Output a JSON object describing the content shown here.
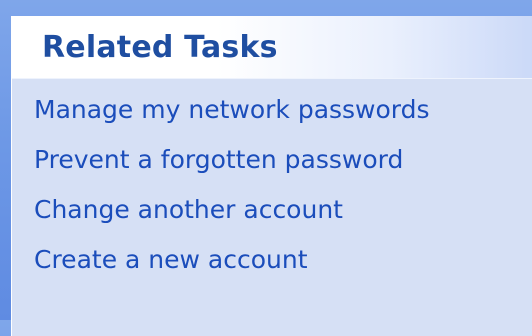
{
  "related_tasks_panel": {
    "title": "Related Tasks",
    "links": [
      {
        "label": "Manage my network passwords"
      },
      {
        "label": "Prevent a forgotten password"
      },
      {
        "label": "Change another account"
      },
      {
        "label": "Create a new account"
      }
    ]
  }
}
